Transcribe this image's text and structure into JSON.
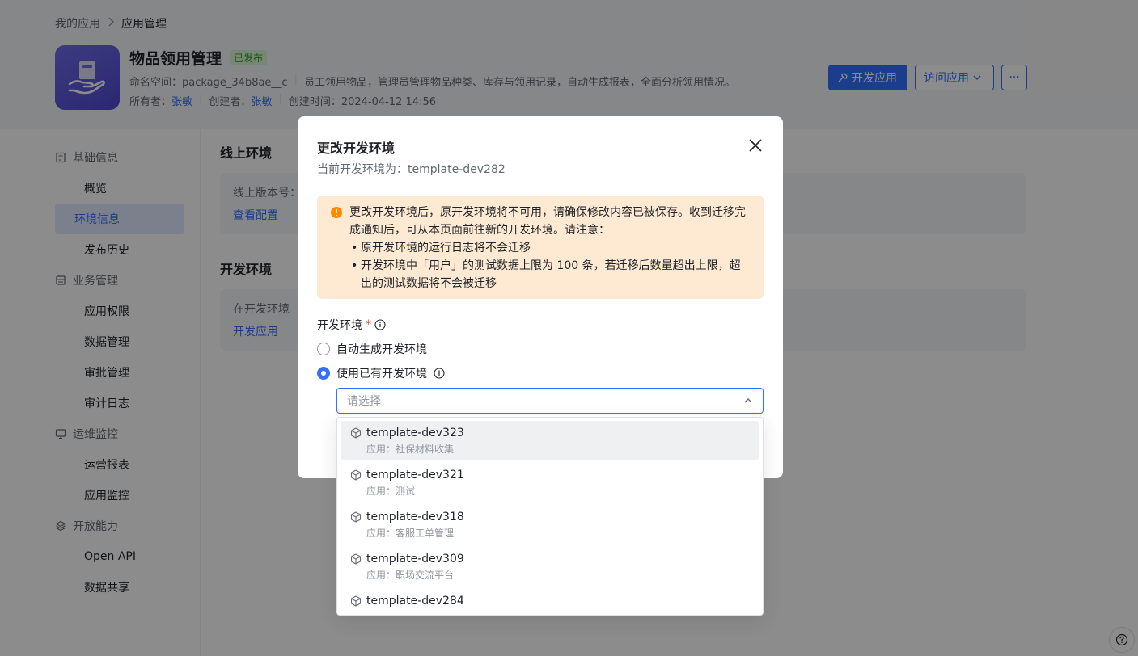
{
  "breadcrumb": {
    "parent": "我的应用",
    "current": "应用管理"
  },
  "app": {
    "name": "物品领用管理",
    "status_badge": "已发布",
    "namespace_label": "命名空间：",
    "namespace_value": "package_34b8ae__c",
    "description": "员工领用物品，管理员管理物品种类、库存与领用记录，自动生成报表，全面分析领用情况。",
    "owner_label": "所有者：",
    "owner": "张敏",
    "creator_label": "创建者：",
    "creator": "张敏",
    "created_label": "创建时间：",
    "created_value": "2024-04-12 14:56"
  },
  "actions": {
    "develop": "开发应用",
    "visit": "访问应用",
    "more": "···"
  },
  "sidebar": {
    "groups": [
      {
        "label": "基础信息",
        "items": [
          "概览",
          "环境信息",
          "发布历史"
        ]
      },
      {
        "label": "业务管理",
        "items": [
          "应用权限",
          "数据管理",
          "审批管理",
          "审计日志"
        ]
      },
      {
        "label": "运维监控",
        "items": [
          "运营报表",
          "应用监控"
        ]
      },
      {
        "label": "开放能力",
        "items": [
          "Open API",
          "数据共享"
        ]
      }
    ],
    "active_item": "环境信息"
  },
  "main": {
    "online_title": "线上环境",
    "online_version_label": "线上版本号：",
    "online_view_config": "查看配置",
    "dev_title": "开发环境",
    "dev_text": "在开发环境",
    "dev_link": "开发应用"
  },
  "modal": {
    "title": "更改开发环境",
    "subtitle": "当前开发环境为：template-dev282",
    "warning": {
      "text": "更改开发环境后，原开发环境将不可用，请确保修改内容已被保存。收到迁移完成通知后，可从本页面前往新的开发环境。请注意：",
      "bullets": [
        "原开发环境的运行日志将不会迁移",
        "开发环境中「用户」的测试数据上限为 100 条，若迁移后数量超出上限，超出的测试数据将不会被迁移"
      ]
    },
    "field_label": "开发环境",
    "required_mark": "*",
    "option_auto": "自动生成开发环境",
    "option_existing": "使用已有开发环境",
    "select_placeholder": "请选择"
  },
  "dropdown": {
    "options": [
      {
        "name": "template-dev323",
        "app": "应用：社保材料收集"
      },
      {
        "name": "template-dev321",
        "app": "应用：测试"
      },
      {
        "name": "template-dev318",
        "app": "应用：客服工单管理"
      },
      {
        "name": "template-dev309",
        "app": "应用：职场交流平台"
      },
      {
        "name": "template-dev284",
        "app": ""
      }
    ]
  },
  "colors": {
    "primary": "#3370ff",
    "warning_bg": "#feead2",
    "warning_icon": "#ff8800",
    "published": "#2ea121"
  }
}
